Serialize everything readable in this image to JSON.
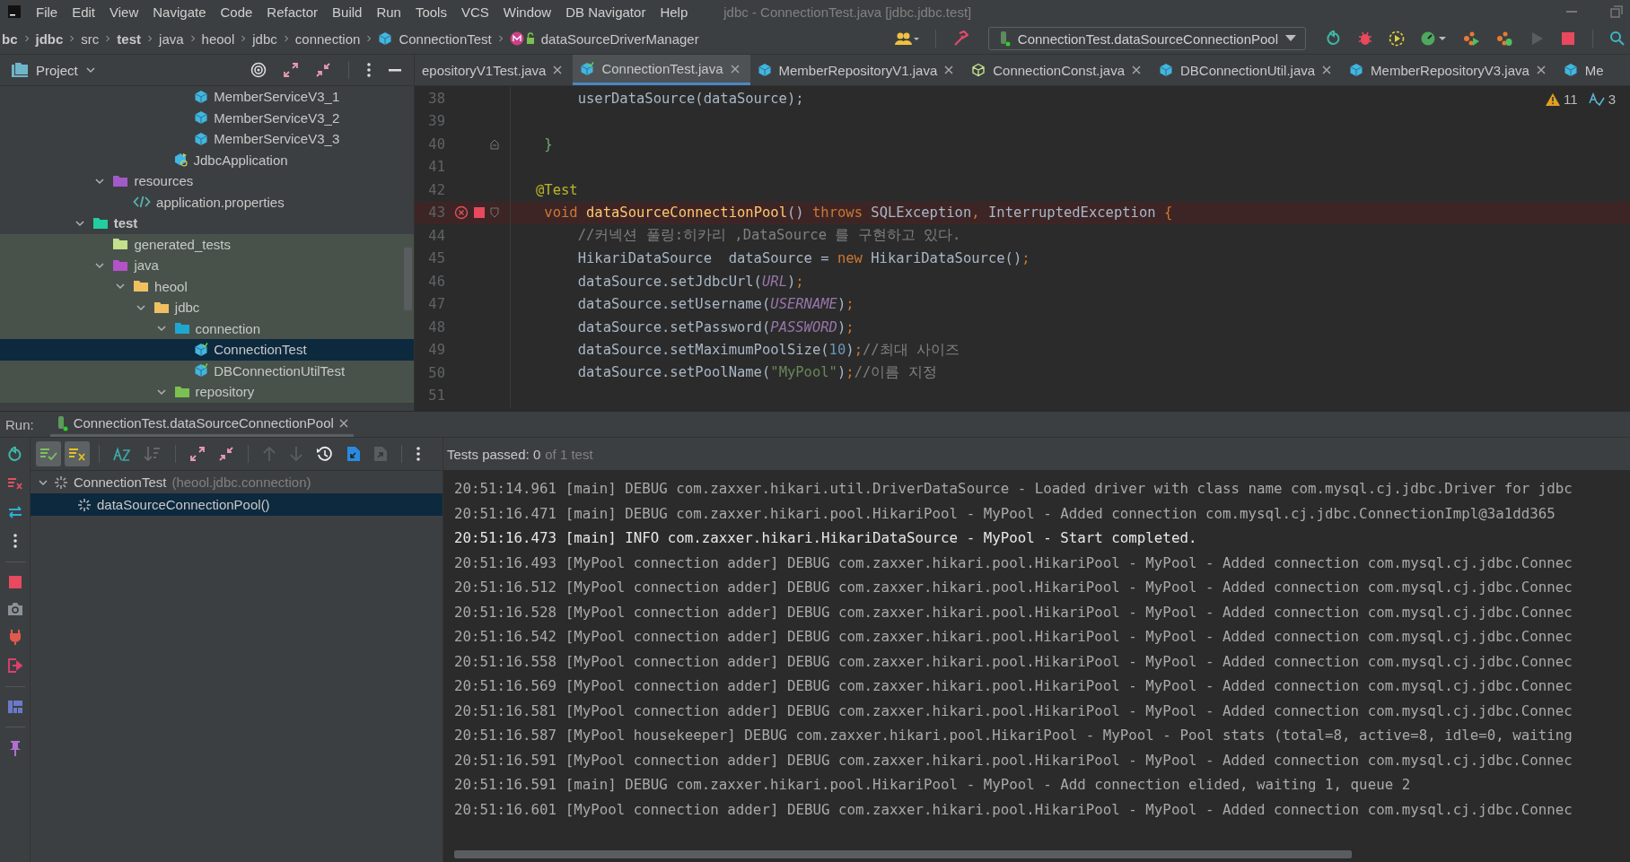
{
  "menu": [
    {
      "label": "File"
    },
    {
      "label": "Edit"
    },
    {
      "label": "View"
    },
    {
      "label": "Navigate"
    },
    {
      "label": "Code"
    },
    {
      "label": "Refactor"
    },
    {
      "label": "Build"
    },
    {
      "label": "Run"
    },
    {
      "label": "Tools"
    },
    {
      "label": "VCS"
    },
    {
      "label": "Window"
    },
    {
      "label": "DB Navigator"
    },
    {
      "label": "Help"
    }
  ],
  "window_title": "jdbc - ConnectionTest.java [jdbc.jdbc.test]",
  "breadcrumbs": [
    {
      "label": "bc",
      "bold": true,
      "kind": "plain"
    },
    {
      "label": "jdbc",
      "bold": true,
      "kind": "plain"
    },
    {
      "label": "src",
      "bold": false,
      "kind": "plain"
    },
    {
      "label": "test",
      "bold": true,
      "kind": "plain"
    },
    {
      "label": "java",
      "bold": false,
      "kind": "plain"
    },
    {
      "label": "heool",
      "bold": false,
      "kind": "plain"
    },
    {
      "label": "jdbc",
      "bold": false,
      "kind": "plain"
    },
    {
      "label": "connection",
      "bold": false,
      "kind": "plain"
    },
    {
      "label": "ConnectionTest",
      "bold": false,
      "kind": "class"
    },
    {
      "label": "dataSourceDriverManager",
      "bold": false,
      "kind": "method"
    }
  ],
  "run_configuration": "ConnectionTest.dataSourceConnectionPool",
  "project_panel": {
    "title": "Project",
    "tree": [
      {
        "children": [
          {
            "children": [
              {
                "children": [
                  {
                    "children": [
                      {
                        "children": [
                          {
                            "children": [
                              {
                                "label": "MemberServiceV3_1",
                                "kind": "class",
                                "selected": false
                              },
                              {
                                "label": "MemberServiceV3_2",
                                "kind": "class",
                                "selected": false
                              },
                              {
                                "label": "MemberServiceV3_3",
                                "kind": "class",
                                "selected": false
                              }
                            ]
                          },
                          {
                            "label": "JdbcApplication",
                            "kind": "app-class",
                            "selected": false
                          }
                        ]
                      }
                    ]
                  }
                ]
              },
              {
                "label": "resources",
                "kind": "resources-folder",
                "expanded": true,
                "selected": false,
                "children": [
                  {
                    "label": "application.properties",
                    "kind": "properties-file",
                    "selected": false
                  }
                ]
              }
            ]
          },
          {
            "label": "test",
            "kind": "test-root-folder",
            "expanded": true,
            "selected": false,
            "children": [
              {
                "label": "generated_tests",
                "kind": "generated-folder",
                "selected": false
              },
              {
                "label": "java",
                "kind": "test-java-folder",
                "expanded": true,
                "selected": false,
                "children": [
                  {
                    "label": "heool",
                    "kind": "package",
                    "expanded": true,
                    "selected": false,
                    "children": [
                      {
                        "label": "jdbc",
                        "kind": "package",
                        "expanded": true,
                        "selected": false,
                        "children": [
                          {
                            "label": "connection",
                            "kind": "test-package",
                            "expanded": true,
                            "selected": false,
                            "children": [
                              {
                                "label": "ConnectionTest",
                                "kind": "test-class",
                                "selected": true
                              },
                              {
                                "label": "DBConnectionUtilTest",
                                "kind": "test-class",
                                "selected": false
                              }
                            ]
                          },
                          {
                            "label": "repository",
                            "kind": "repository-package",
                            "expanded": true,
                            "selected": false
                          }
                        ]
                      }
                    ]
                  }
                ]
              }
            ]
          }
        ]
      }
    ]
  },
  "editor": {
    "tabs": [
      {
        "label": "epositoryV1Test.java",
        "kind": "none",
        "selected": false,
        "closable": true
      },
      {
        "label": "ConnectionTest.java",
        "kind": "test-class",
        "selected": true,
        "closable": true
      },
      {
        "label": "MemberRepositoryV1.java",
        "kind": "class",
        "selected": false,
        "closable": true
      },
      {
        "label": "ConnectionConst.java",
        "kind": "const",
        "selected": false,
        "closable": true
      },
      {
        "label": "DBConnectionUtil.java",
        "kind": "class",
        "selected": false,
        "closable": true
      },
      {
        "label": "MemberRepositoryV3.java",
        "kind": "class",
        "selected": false,
        "closable": true
      },
      {
        "label": "Me",
        "kind": "class",
        "selected": false,
        "closable": false
      }
    ],
    "warnings": "11",
    "typos": "3",
    "lines": [
      {
        "number": "38",
        "error": false,
        "segments": [
          {
            "kind": "plain",
            "text": "        userDataSource(dataSource);"
          }
        ]
      },
      {
        "number": "39",
        "error": false
      },
      {
        "number": "40",
        "error": false,
        "fold_end": true,
        "segments": [
          {
            "kind": "brace",
            "text": "    }"
          }
        ]
      },
      {
        "number": "41",
        "error": false
      },
      {
        "number": "42",
        "error": false,
        "segments": [
          {
            "kind": "annotation",
            "text": "   @Test"
          }
        ]
      },
      {
        "number": "43",
        "error": true,
        "fold_start": true,
        "segments": [
          {
            "kind": "keyword",
            "text": "    void "
          },
          {
            "kind": "method",
            "text": "dataSourceConnectionPool"
          },
          {
            "kind": "plain",
            "text": "() "
          },
          {
            "kind": "keyword",
            "text": "throws"
          },
          {
            "kind": "plain",
            "text": " SQLException"
          },
          {
            "kind": "keyword",
            "text": ","
          },
          {
            "kind": "plain",
            "text": " InterruptedException "
          },
          {
            "kind": "keyword",
            "text": "{"
          }
        ]
      },
      {
        "number": "44",
        "error": false,
        "segments": [
          {
            "kind": "comment",
            "text": "        //커넥션 풀링:히카리 ,DataSource 를 구현하고 있다."
          }
        ]
      },
      {
        "number": "45",
        "error": false,
        "segments": [
          {
            "kind": "plain",
            "text": "        HikariDataSource  dataSource = "
          },
          {
            "kind": "keyword",
            "text": "new"
          },
          {
            "kind": "plain",
            "text": " HikariDataSource()"
          },
          {
            "kind": "keyword",
            "text": ";"
          }
        ]
      },
      {
        "number": "46",
        "error": false,
        "segments": [
          {
            "kind": "plain",
            "text": "        dataSource.setJdbcUrl("
          },
          {
            "kind": "constant",
            "text": "URL"
          },
          {
            "kind": "plain",
            "text": ")"
          },
          {
            "kind": "keyword",
            "text": ";"
          }
        ]
      },
      {
        "number": "47",
        "error": false,
        "segments": [
          {
            "kind": "plain",
            "text": "        dataSource.setUsername("
          },
          {
            "kind": "constant",
            "text": "USERNAME"
          },
          {
            "kind": "plain",
            "text": ")"
          },
          {
            "kind": "keyword",
            "text": ";"
          }
        ]
      },
      {
        "number": "48",
        "error": false,
        "segments": [
          {
            "kind": "plain",
            "text": "        dataSource.setPassword("
          },
          {
            "kind": "constant",
            "text": "PASSWORD"
          },
          {
            "kind": "plain",
            "text": ")"
          },
          {
            "kind": "keyword",
            "text": ";"
          }
        ]
      },
      {
        "number": "49",
        "error": false,
        "segments": [
          {
            "kind": "plain",
            "text": "        dataSource.setMaximumPoolSize("
          },
          {
            "kind": "number",
            "text": "10"
          },
          {
            "kind": "plain",
            "text": ")"
          },
          {
            "kind": "keyword",
            "text": ";"
          },
          {
            "kind": "comment",
            "text": "//최대 사이즈"
          }
        ]
      },
      {
        "number": "50",
        "error": false,
        "segments": [
          {
            "kind": "plain",
            "text": "        dataSource.setPoolName("
          },
          {
            "kind": "string",
            "text": "\"MyPool\""
          },
          {
            "kind": "plain",
            "text": ")"
          },
          {
            "kind": "keyword",
            "text": ";"
          },
          {
            "kind": "comment",
            "text": "//이름 지정"
          }
        ]
      },
      {
        "number": "51",
        "error": false
      }
    ]
  },
  "run_panel": {
    "label": "Run:",
    "tab": "ConnectionTest.dataSourceConnectionPool",
    "show_passed": true,
    "show_ignored": true,
    "tests": [
      {
        "label": "ConnectionTest",
        "detail": "(heool.jdbc.connection)",
        "expanded": true,
        "selected": false,
        "children": [
          {
            "label": "dataSourceConnectionPool()",
            "selected": true
          }
        ]
      }
    ],
    "status": "Tests passed: 0",
    "status_detail": "of 1 test",
    "console": [
      {
        "kind": "debug",
        "text": "20:51:14.961 [main] DEBUG com.zaxxer.hikari.util.DriverDataSource - Loaded driver with class name com.mysql.cj.jdbc.Driver for jdbc"
      },
      {
        "kind": "debug",
        "text": "20:51:16.471 [main] DEBUG com.zaxxer.hikari.pool.HikariPool - MyPool - Added connection com.mysql.cj.jdbc.ConnectionImpl@3a1dd365"
      },
      {
        "kind": "info",
        "text": "20:51:16.473 [main] INFO com.zaxxer.hikari.HikariDataSource - MyPool - Start completed."
      },
      {
        "kind": "debug",
        "text": "20:51:16.493 [MyPool connection adder] DEBUG com.zaxxer.hikari.pool.HikariPool - MyPool - Added connection com.mysql.cj.jdbc.Connec"
      },
      {
        "kind": "debug",
        "text": "20:51:16.512 [MyPool connection adder] DEBUG com.zaxxer.hikari.pool.HikariPool - MyPool - Added connection com.mysql.cj.jdbc.Connec"
      },
      {
        "kind": "debug",
        "text": "20:51:16.528 [MyPool connection adder] DEBUG com.zaxxer.hikari.pool.HikariPool - MyPool - Added connection com.mysql.cj.jdbc.Connec"
      },
      {
        "kind": "debug",
        "text": "20:51:16.542 [MyPool connection adder] DEBUG com.zaxxer.hikari.pool.HikariPool - MyPool - Added connection com.mysql.cj.jdbc.Connec"
      },
      {
        "kind": "debug",
        "text": "20:51:16.558 [MyPool connection adder] DEBUG com.zaxxer.hikari.pool.HikariPool - MyPool - Added connection com.mysql.cj.jdbc.Connec"
      },
      {
        "kind": "debug",
        "text": "20:51:16.569 [MyPool connection adder] DEBUG com.zaxxer.hikari.pool.HikariPool - MyPool - Added connection com.mysql.cj.jdbc.Connec"
      },
      {
        "kind": "debug",
        "text": "20:51:16.581 [MyPool connection adder] DEBUG com.zaxxer.hikari.pool.HikariPool - MyPool - Added connection com.mysql.cj.jdbc.Connec"
      },
      {
        "kind": "debug",
        "text": "20:51:16.587 [MyPool housekeeper] DEBUG com.zaxxer.hikari.pool.HikariPool - MyPool - Pool stats (total=8, active=8, idle=0, waiting"
      },
      {
        "kind": "debug",
        "text": "20:51:16.591 [MyPool connection adder] DEBUG com.zaxxer.hikari.pool.HikariPool - MyPool - Added connection com.mysql.cj.jdbc.Connec"
      },
      {
        "kind": "debug",
        "text": "20:51:16.591 [main] DEBUG com.zaxxer.hikari.pool.HikariPool - MyPool - Add connection elided, waiting 1, queue 2"
      },
      {
        "kind": "debug",
        "text": "20:51:16.601 [MyPool connection adder] DEBUG com.zaxxer.hikari.pool.HikariPool - MyPool - Added connection com.mysql.cj.jdbc.Connec"
      }
    ]
  }
}
